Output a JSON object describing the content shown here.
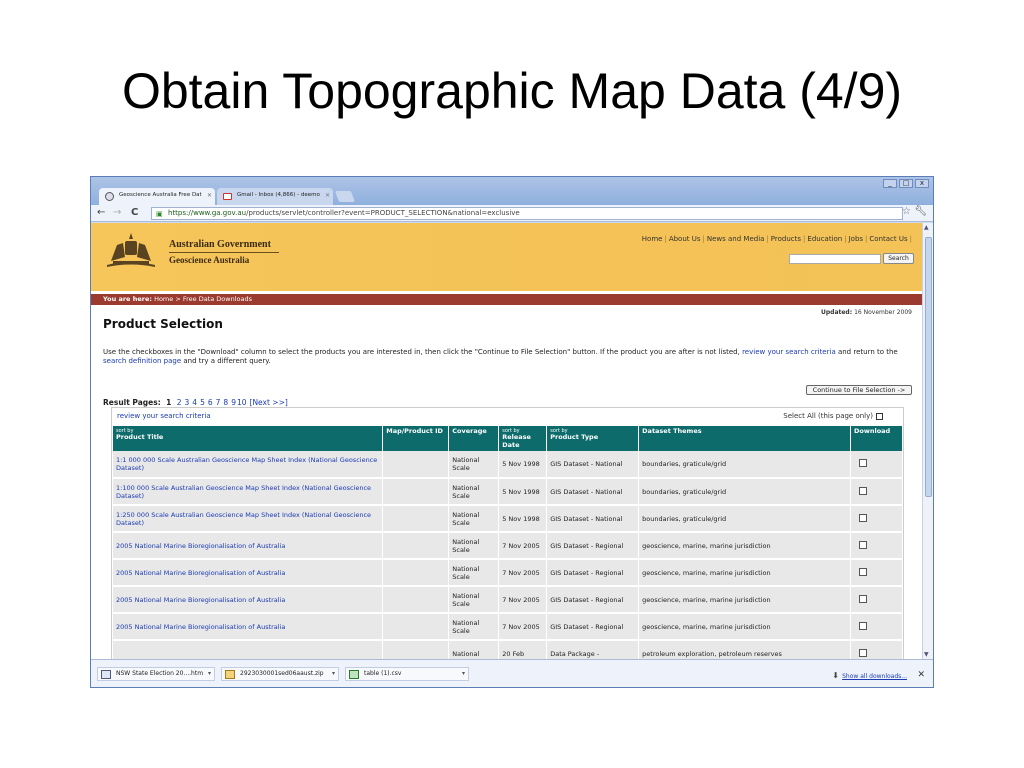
{
  "slide": {
    "title": "Obtain Topographic Map Data (4/9)"
  },
  "browser": {
    "tabs": [
      {
        "label": "Geoscience Australia Free Dat",
        "icon": "globe-icon"
      },
      {
        "label": "Gmail - Inbox (4,866) - deemo",
        "icon": "gmail-icon"
      }
    ],
    "window_buttons": [
      "_",
      "□",
      "x"
    ],
    "url_scheme": "https://",
    "url_host": "www.ga.gov.au",
    "url_path": "/products/servlet/controller?event=PRODUCT_SELECTION&national=exclusive",
    "colors": {
      "accent": "#0d6b6b",
      "header": "#f4c256",
      "breadcrumb": "#9b3a2f",
      "link": "#1a3bb3"
    }
  },
  "site": {
    "gov_name": "Australian Government",
    "agency_name": "Geoscience Australia",
    "topnav": [
      "Home",
      "About Us",
      "News and Media",
      "Products",
      "Education",
      "Jobs",
      "Contact Us"
    ],
    "search_button": "Search",
    "breadcrumb_label": "You are here:",
    "breadcrumb_path": "Home > Free Data Downloads",
    "updated_label": "Updated:",
    "updated_date": "16 November 2009",
    "page_title": "Product Selection",
    "instructions_1": "Use the checkboxes in the \"Download\" column to select the products you are interested in, then click the \"Continue to File Selection\" button. If the product you are after is not listed, ",
    "instructions_link1": "review your search criteria",
    "instructions_2": " and return to the ",
    "instructions_link2": "search definition page",
    "instructions_3": " and try a different query.",
    "continue_button": "Continue to File Selection ->",
    "result_pages_label": "Result Pages:",
    "current_page": "1",
    "pages": [
      "2",
      "3",
      "4",
      "5",
      "6",
      "7",
      "8",
      "9",
      "10",
      "[Next >>]"
    ],
    "review_link": "review your search criteria",
    "select_all": "Select All (this page only)"
  },
  "table": {
    "sort_by": "sort by",
    "headers": [
      "Product Title",
      "Map/Product ID",
      "Coverage",
      "Release Date",
      "Product Type",
      "Dataset Themes",
      "Download"
    ],
    "rows": [
      {
        "title": "1:1 000 000 Scale Australian Geoscience Map Sheet Index (National Geoscience Dataset)",
        "id": "",
        "coverage": "National Scale",
        "date": "5 Nov 1998",
        "type": "GIS Dataset - National",
        "themes": "boundaries, graticule/grid"
      },
      {
        "title": "1:100 000 Scale Australian Geoscience Map Sheet Index (National Geoscience Dataset)",
        "id": "",
        "coverage": "National Scale",
        "date": "5 Nov 1998",
        "type": "GIS Dataset - National",
        "themes": "boundaries, graticule/grid"
      },
      {
        "title": "1:250 000 Scale Australian Geoscience Map Sheet Index (National Geoscience Dataset)",
        "id": "",
        "coverage": "National Scale",
        "date": "5 Nov 1998",
        "type": "GIS Dataset - National",
        "themes": "boundaries, graticule/grid"
      },
      {
        "title": "2005 National Marine Bioregionalisation of Australia",
        "id": "",
        "coverage": "National Scale",
        "date": "7 Nov 2005",
        "type": "GIS Dataset - Regional",
        "themes": "geoscience, marine, marine jurisdiction"
      },
      {
        "title": "2005 National Marine Bioregionalisation of Australia",
        "id": "",
        "coverage": "National Scale",
        "date": "7 Nov 2005",
        "type": "GIS Dataset - Regional",
        "themes": "geoscience, marine, marine jurisdiction"
      },
      {
        "title": "2005 National Marine Bioregionalisation of Australia",
        "id": "",
        "coverage": "National Scale",
        "date": "7 Nov 2005",
        "type": "GIS Dataset - Regional",
        "themes": "geoscience, marine, marine jurisdiction"
      },
      {
        "title": "2005 National Marine Bioregionalisation of Australia",
        "id": "",
        "coverage": "National Scale",
        "date": "7 Nov 2005",
        "type": "GIS Dataset - Regional",
        "themes": "geoscience, marine, marine jurisdiction"
      },
      {
        "title": "",
        "id": "",
        "coverage": "National",
        "date": "20 Feb",
        "type": "Data Package -",
        "themes": "petroleum exploration, petroleum reserves"
      }
    ]
  },
  "downloads": {
    "items": [
      {
        "label": "NSW State Election 20....htm",
        "icon": "web-page-icon"
      },
      {
        "label": "2923030001sed06aaust.zip",
        "icon": "zip-file-icon"
      },
      {
        "label": "table (1).csv",
        "icon": "spreadsheet-icon"
      }
    ],
    "show_all": "Show all downloads..."
  }
}
